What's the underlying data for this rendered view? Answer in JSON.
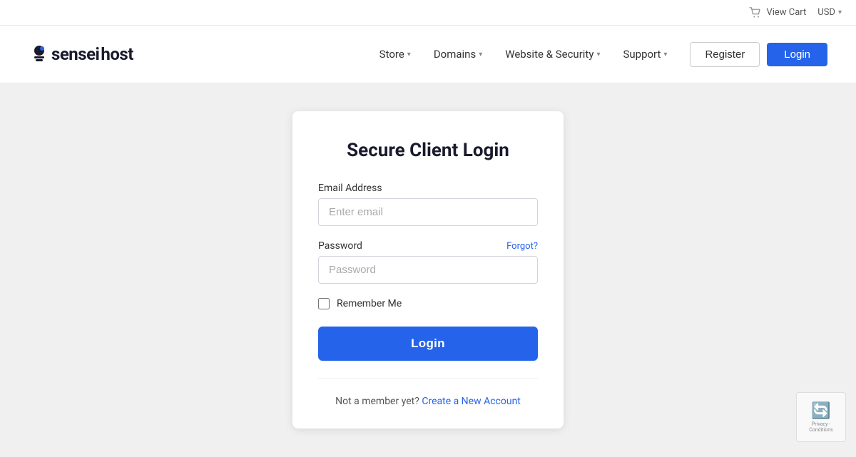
{
  "topbar": {
    "view_cart_label": "View Cart",
    "currency_label": "USD",
    "currency_chevron": "▾"
  },
  "navbar": {
    "logo_text_1": "sensei",
    "logo_text_2": "host",
    "nav_items": [
      {
        "id": "store",
        "label": "Store",
        "has_dropdown": true
      },
      {
        "id": "domains",
        "label": "Domains",
        "has_dropdown": true
      },
      {
        "id": "website-security",
        "label": "Website & Security",
        "has_dropdown": true
      },
      {
        "id": "support",
        "label": "Support",
        "has_dropdown": true
      }
    ],
    "register_label": "Register",
    "login_label": "Login"
  },
  "login_card": {
    "title": "Secure Client Login",
    "email_label": "Email Address",
    "email_placeholder": "Enter email",
    "password_label": "Password",
    "password_placeholder": "Password",
    "forgot_label": "Forgot?",
    "remember_label": "Remember Me",
    "login_button": "Login",
    "footer_text": "Not a member yet?",
    "create_account_label": "Create a New Account"
  },
  "recaptcha": {
    "text": "Privacy - Conditions"
  }
}
